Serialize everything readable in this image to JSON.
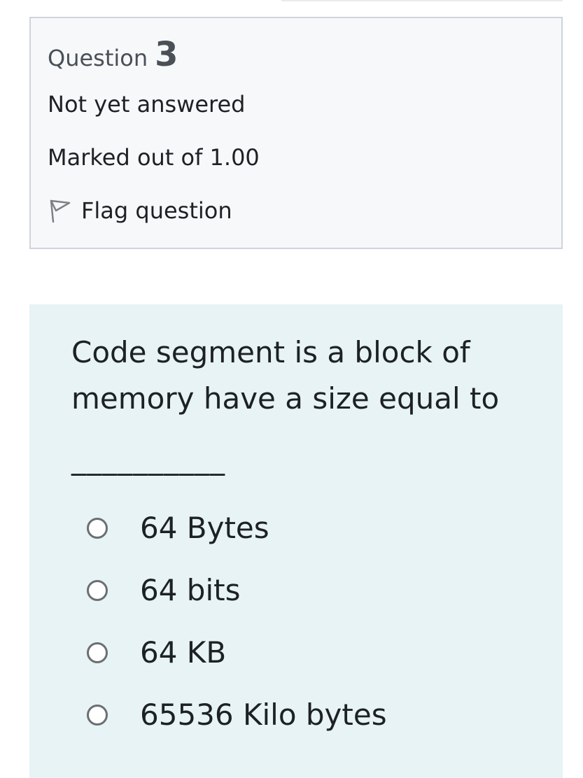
{
  "question_info": {
    "label": "Question",
    "number": "3",
    "state": "Not yet answered",
    "grade": "Marked out of 1.00",
    "flag": {
      "label": "Flag question",
      "icon": "flag-icon"
    }
  },
  "question": {
    "text": "Code segment is a block of memory have a size equal to",
    "blank": "__________",
    "answers": [
      {
        "label": "64 Bytes",
        "selected": false
      },
      {
        "label": "64 bits",
        "selected": false
      },
      {
        "label": "64 KB",
        "selected": false
      },
      {
        "label": "65536 Kilo bytes",
        "selected": false
      }
    ]
  },
  "colors": {
    "info_background": "#f7f8fa",
    "info_border": "#cfd4da",
    "content_background": "#e7f3f5",
    "text": "#1d2125",
    "muted_text": "#495057",
    "radio_border": "#6a6f73"
  }
}
